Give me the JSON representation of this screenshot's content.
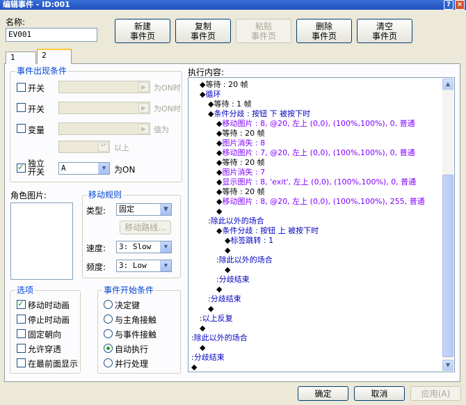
{
  "window": {
    "title": "编辑事件 - ID:001",
    "help_glyph": "?",
    "close_glyph": "×"
  },
  "name": {
    "label": "名称:",
    "value": "EV001"
  },
  "toolbar": {
    "new_line1": "新建",
    "new_line2": "事件页",
    "copy_line1": "复制",
    "copy_line2": "事件页",
    "paste_line1": "粘贴",
    "paste_line2": "事件页",
    "delete_line1": "删除",
    "delete_line2": "事件页",
    "clear_line1": "清空",
    "clear_line2": "事件页"
  },
  "tabs": [
    {
      "label": "1"
    },
    {
      "label": "2"
    }
  ],
  "conditions": {
    "title": "事件出现条件",
    "switch1": {
      "label": "开关",
      "suffix": "为ON时",
      "checked": false
    },
    "switch2": {
      "label": "开关",
      "suffix": "为ON时",
      "checked": false
    },
    "variable": {
      "label": "变量",
      "suffix": "值为",
      "suffix2": "以上",
      "checked": false
    },
    "self_switch": {
      "label_line1": "独立",
      "label_line2": "开关",
      "value": "A",
      "suffix": "为ON",
      "checked": true
    },
    "arrow_glyph": "▶",
    "drop_glyph": "▼",
    "spin_glyph": "▴▾"
  },
  "graphic": {
    "label": "角色图片:"
  },
  "move_rule": {
    "title": "移动规则",
    "type_label": "类型:",
    "type_value": "固定",
    "route_button": "移动路线...",
    "speed_label": "速度:",
    "speed_value": "3: Slow",
    "freq_label": "频度:",
    "freq_value": "3: Low"
  },
  "options": {
    "title": "选项",
    "items": [
      {
        "label": "移动时动画",
        "checked": true
      },
      {
        "label": "停止时动画",
        "checked": false
      },
      {
        "label": "固定朝向",
        "checked": false
      },
      {
        "label": "允许穿透",
        "checked": false
      },
      {
        "label": "在最前面显示",
        "checked": false
      }
    ]
  },
  "trigger": {
    "title": "事件开始条件",
    "items": [
      {
        "label": "决定键",
        "checked": false
      },
      {
        "label": "与主角接触",
        "checked": false
      },
      {
        "label": "与事件接触",
        "checked": false
      },
      {
        "label": "自动执行",
        "checked": true
      },
      {
        "label": "并行处理",
        "checked": false
      }
    ]
  },
  "commands": {
    "label": "执行内容:",
    "lines": [
      {
        "indent": 0,
        "bullet": "◆",
        "text": "等待 : 20 帧",
        "color": "black"
      },
      {
        "indent": 0,
        "bullet": "◆",
        "text": "循环",
        "color": "blue"
      },
      {
        "indent": 1,
        "bullet": "◆",
        "text": "等待 : 1 帧",
        "color": "black"
      },
      {
        "indent": 1,
        "bullet": "◆",
        "text": "条件分歧 : 按钮 下 被按下时",
        "color": "blue"
      },
      {
        "indent": 2,
        "bullet": "◆",
        "text": "移动图片 : 8, @20, 左上 (0,0), (100%,100%), 0, 普通",
        "color": "purple"
      },
      {
        "indent": 2,
        "bullet": "◆",
        "text": "等待 : 20 帧",
        "color": "black"
      },
      {
        "indent": 2,
        "bullet": "◆",
        "text": "图片消失 : 8",
        "color": "purple"
      },
      {
        "indent": 2,
        "bullet": "◆",
        "text": "移动图片 : 7, @20, 左上 (0,0), (100%,100%), 0, 普通",
        "color": "purple"
      },
      {
        "indent": 2,
        "bullet": "◆",
        "text": "等待 : 20 帧",
        "color": "black"
      },
      {
        "indent": 2,
        "bullet": "◆",
        "text": "图片消失 : 7",
        "color": "purple"
      },
      {
        "indent": 2,
        "bullet": "◆",
        "text": "显示图片 : 8, 'exit', 左上 (0,0), (100%,100%), 0, 普通",
        "color": "purple"
      },
      {
        "indent": 2,
        "bullet": "◆",
        "text": "等待 : 20 帧",
        "color": "black"
      },
      {
        "indent": 2,
        "bullet": "◆",
        "text": "移动图片 : 8, @20, 左上 (0,0), (100%,100%), 255, 普通",
        "color": "purple"
      },
      {
        "indent": 2,
        "bullet": "◆",
        "text": "",
        "color": "black"
      },
      {
        "indent": 1,
        "bullet": ":",
        "text": "除此以外的场合",
        "color": "blue"
      },
      {
        "indent": 2,
        "bullet": "◆",
        "text": "条件分歧 : 按钮 上 被按下时",
        "color": "blue"
      },
      {
        "indent": 3,
        "bullet": "◆",
        "text": "标签跳转 : 1",
        "color": "blue"
      },
      {
        "indent": 3,
        "bullet": "◆",
        "text": "",
        "color": "black"
      },
      {
        "indent": 2,
        "bullet": ":",
        "text": "除此以外的场合",
        "color": "blue"
      },
      {
        "indent": 3,
        "bullet": "◆",
        "text": "",
        "color": "black"
      },
      {
        "indent": 2,
        "bullet": ":",
        "text": "分歧结束",
        "color": "blue"
      },
      {
        "indent": 2,
        "bullet": "◆",
        "text": "",
        "color": "black"
      },
      {
        "indent": 1,
        "bullet": ":",
        "text": "分歧结束",
        "color": "blue"
      },
      {
        "indent": 1,
        "bullet": "◆",
        "text": "",
        "color": "black"
      },
      {
        "indent": 0,
        "bullet": ":",
        "text": "以上反复",
        "color": "blue"
      },
      {
        "indent": 0,
        "bullet": "◆",
        "text": "",
        "color": "black"
      },
      {
        "indent": -1,
        "bullet": ":",
        "text": "除此以外的场合",
        "color": "blue"
      },
      {
        "indent": 0,
        "bullet": "◆",
        "text": "",
        "color": "black"
      },
      {
        "indent": -1,
        "bullet": ":",
        "text": "分歧结束",
        "color": "blue"
      },
      {
        "indent": -1,
        "bullet": "◆",
        "text": "",
        "color": "black"
      }
    ],
    "scroll_up_glyph": "▲",
    "scroll_down_glyph": "▼"
  },
  "footer": {
    "ok": "确定",
    "cancel": "取消",
    "apply": "应用(A)"
  }
}
